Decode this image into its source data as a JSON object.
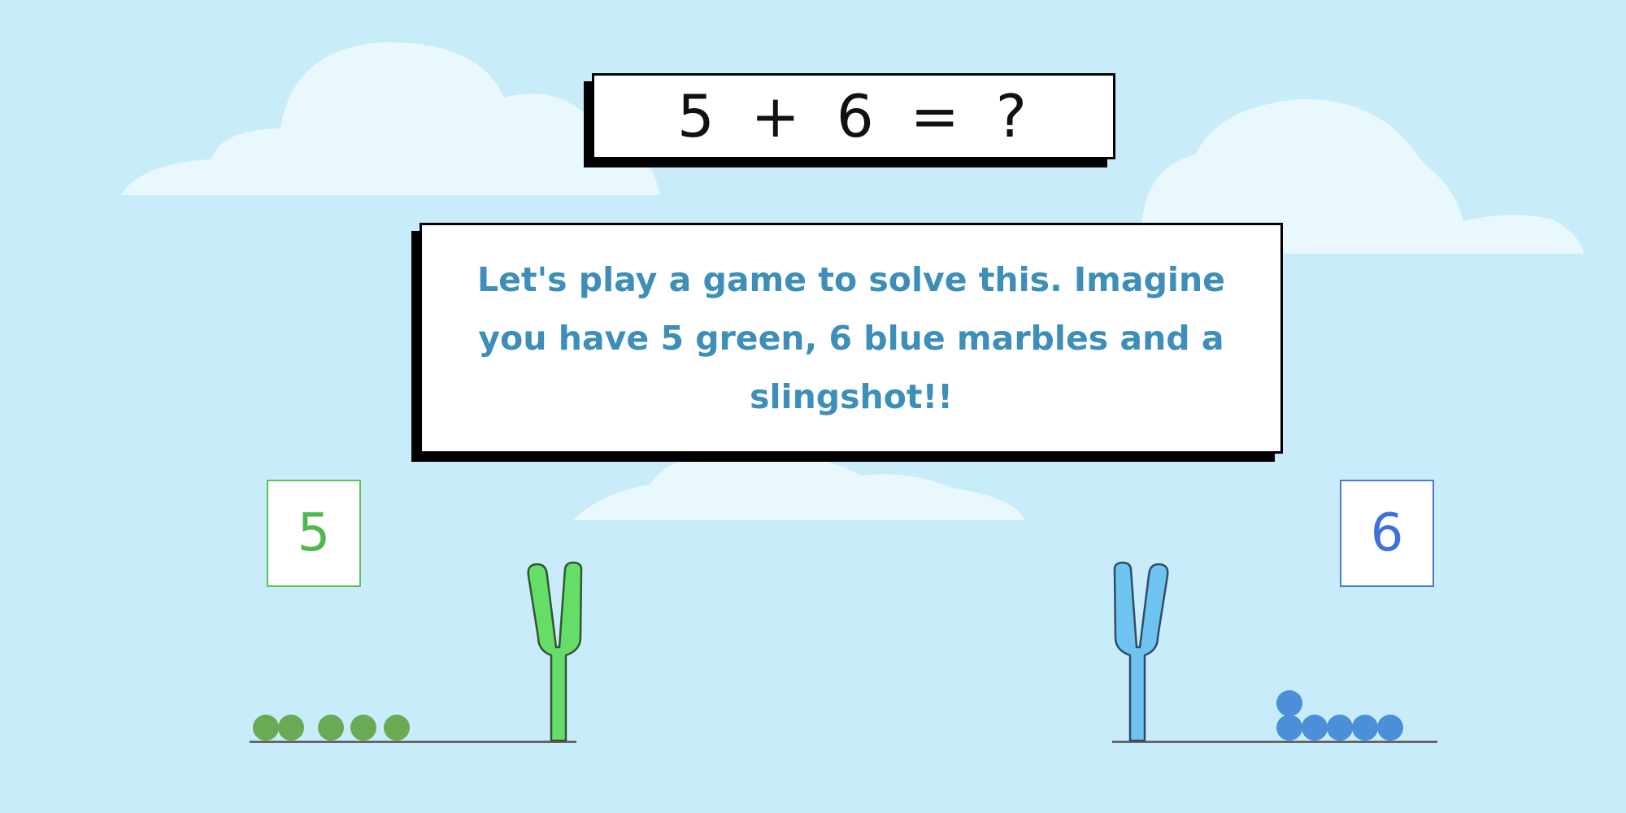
{
  "equation": "5 + 6 = ?",
  "story": "Let's play a game to solve this. Imagine you have 5 green, 6 blue marbles and a slingshot!!",
  "left": {
    "count": "5",
    "color": "#59c459",
    "marbles": 5,
    "marble_color": "#6aaa54",
    "slingshot_color": "#66dd66"
  },
  "right": {
    "count": "6",
    "color": "#4a78e0",
    "marbles": 6,
    "marble_color": "#4a8fd8",
    "slingshot_color": "#6ec3f0"
  },
  "background_color": "#c8ecfa"
}
